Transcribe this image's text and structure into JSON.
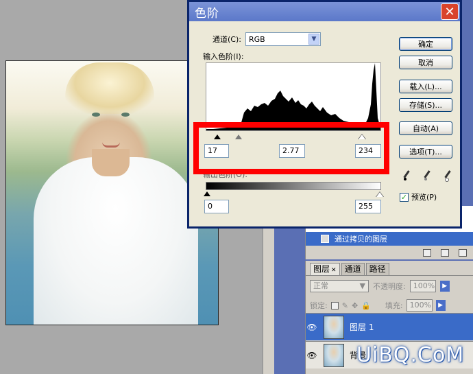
{
  "dialog": {
    "title": "色阶",
    "channel_label": "通道(C):",
    "channel_value": "RGB",
    "input_label": "输入色阶(I):",
    "input_black": "17",
    "input_gamma": "2.77",
    "input_white": "234",
    "output_label": "输出色阶(O):",
    "output_black": "0",
    "output_white": "255",
    "buttons": {
      "ok": "确定",
      "cancel": "取消",
      "load": "载入(L)...",
      "save": "存储(S)...",
      "auto": "自动(A)",
      "options": "选项(T)..."
    },
    "preview_label": "预览(P)",
    "preview_checked": true
  },
  "history": {
    "selected_item": "通过拷贝的图层"
  },
  "layers": {
    "tabs": [
      {
        "label": "图层",
        "closable": true
      },
      {
        "label": "通道"
      },
      {
        "label": "路径"
      }
    ],
    "blend_mode": "正常",
    "opacity_label": "不透明度:",
    "opacity_value": "100%",
    "lock_label": "锁定:",
    "fill_label": "填充:",
    "fill_value": "100%",
    "items": [
      {
        "name": "图层 1",
        "selected": true
      },
      {
        "name": "背景",
        "selected": false
      }
    ]
  },
  "watermark": "UiBQ.CoM",
  "colors": {
    "highlight": "#ff0000",
    "titlebar": "#5b78c9",
    "selection": "#3a6bc8"
  }
}
